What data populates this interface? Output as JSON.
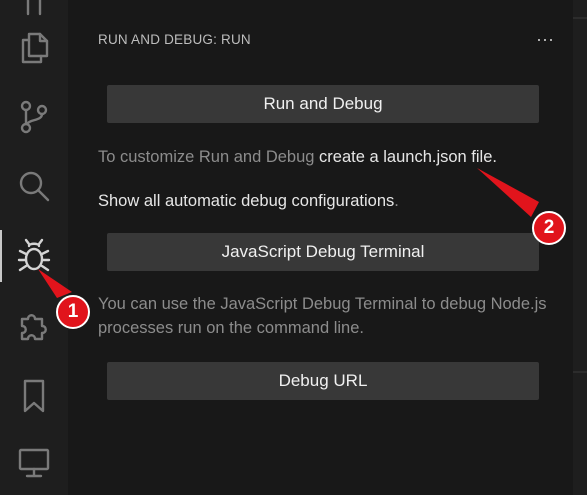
{
  "panel": {
    "header": "RUN AND DEBUG: RUN",
    "more_label": "···",
    "run_debug_button": "Run and Debug",
    "customize_prefix": "To customize Run and Debug ",
    "customize_link": "create a launch.json file",
    "customize_suffix": ".",
    "show_configs_link": "Show all automatic debug configurations",
    "show_configs_suffix": ".",
    "js_terminal_button": "JavaScript Debug Terminal",
    "js_terminal_description": "You can use the JavaScript Debug Terminal to debug Node.js processes run on the command line.",
    "debug_url_button": "Debug URL"
  },
  "activity_bar": {
    "items": [
      {
        "icon": "files-icon"
      },
      {
        "icon": "source-control-icon"
      },
      {
        "icon": "search-icon"
      },
      {
        "icon": "run-debug-icon",
        "active": true
      },
      {
        "icon": "extensions-icon"
      },
      {
        "icon": "bookmark-icon"
      },
      {
        "icon": "remote-explorer-icon"
      }
    ]
  },
  "annotations": {
    "badge_1": "1",
    "badge_2": "2",
    "color": "#e1141c"
  }
}
